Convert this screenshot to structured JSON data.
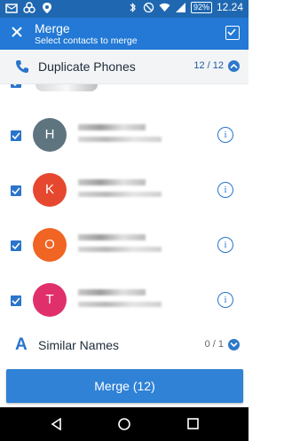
{
  "status_bar": {
    "time": "12.24",
    "battery": "92%"
  },
  "app_bar": {
    "title": "Merge",
    "subtitle": "Select contacts to merge"
  },
  "sections": {
    "duplicate_phones": {
      "label": "Duplicate Phones",
      "count": "12 / 12"
    },
    "similar_names": {
      "icon_letter": "A",
      "label": "Similar Names",
      "count": "0 / 1"
    }
  },
  "contacts": [
    {
      "initial": "H",
      "color": "#5e7580"
    },
    {
      "initial": "K",
      "color": "#e6482f"
    },
    {
      "initial": "O",
      "color": "#f06424"
    },
    {
      "initial": "T",
      "color": "#e0306b"
    }
  ],
  "info_glyph": "i",
  "merge_button": {
    "label": "Merge (12)"
  },
  "colors": {
    "status_bar": "#1f67b0",
    "app_bar": "#2379d5",
    "accent": "#2a74cc"
  }
}
